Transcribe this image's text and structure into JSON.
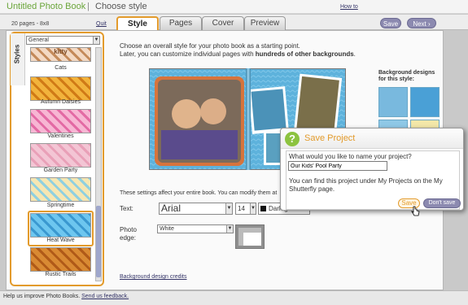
{
  "header": {
    "app_title": "Untitled Photo Book",
    "separator": "|",
    "step_title": "Choose style",
    "howto_link": "How to"
  },
  "nav": {
    "pages_info": "20 pages - 8x8",
    "quit_link": "Quit",
    "tabs": [
      {
        "label": "Style",
        "active": true
      },
      {
        "label": "Pages",
        "active": false
      },
      {
        "label": "Cover",
        "active": false
      },
      {
        "label": "Preview",
        "active": false
      }
    ],
    "save_label": "Save",
    "next_label": "Next"
  },
  "sidebar": {
    "tab_label": "Styles",
    "category": "General",
    "styles": [
      {
        "name": "Cats",
        "thumb_text": "kitty",
        "colors": [
          "#f3d9c4",
          "#c48a5a"
        ]
      },
      {
        "name": "Autumn Daisies",
        "colors": [
          "#f2b33c",
          "#d07a16"
        ]
      },
      {
        "name": "Valentines",
        "colors": [
          "#f7b6d3",
          "#e36aa4"
        ]
      },
      {
        "name": "Garden Party",
        "colors": [
          "#f3c5d4",
          "#e9a0b8"
        ]
      },
      {
        "name": "Springtime",
        "colors": [
          "#f6e6b2",
          "#8fd0e0"
        ]
      },
      {
        "name": "Heat Wave",
        "colors": [
          "#6dc6ef",
          "#3a98d0"
        ]
      },
      {
        "name": "Rustic Trails",
        "colors": [
          "#d98a33",
          "#b05a18"
        ]
      }
    ]
  },
  "main": {
    "intro_line1": "Choose an overall style for your photo book as a starting point.",
    "intro_line2_prefix": "Later, you can customize individual pages with ",
    "intro_line2_bold": "hundreds of other backgrounds",
    "intro_line2_suffix": ".",
    "bg_designs_label": "Background designs for this style:",
    "settings_note": "These settings affect your entire book. You can modify them at",
    "text_label": "Text:",
    "font_value": "Arial",
    "size_value": "14",
    "color_value": "Dark g",
    "edge_label": "Photo edge:",
    "edge_value": "White",
    "credits_link": "Background design credits"
  },
  "footer": {
    "help_text": "Help us improve Photo Books. ",
    "feedback_link": "Send us feedback."
  },
  "dialog": {
    "title": "Save Project",
    "icon_glyph": "?",
    "question": "What would you like to name your project?",
    "project_name": "Our Kids' Pool Party",
    "info": "You can find this project under My Projects on the My Shutterfly page.",
    "save_label": "Save",
    "dont_save_label": "Don't save"
  },
  "colors": {
    "accent_orange": "#e39b2c",
    "button_purple": "#8c8ab0",
    "title_green": "#6aa53a",
    "book_blue": "#5db2dc"
  }
}
